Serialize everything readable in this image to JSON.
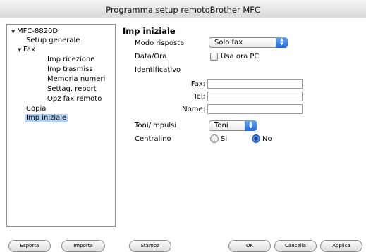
{
  "window": {
    "title": "Programma setup remotoBrother MFC"
  },
  "tree": {
    "root": "MFC-8820D",
    "items": [
      {
        "label": "Setup generale"
      },
      {
        "label": "Fax"
      },
      {
        "label": "Imp ricezione"
      },
      {
        "label": "Imp trasmiss"
      },
      {
        "label": "Memoria numeri"
      },
      {
        "label": "Settag. report"
      },
      {
        "label": "Opz fax remoto"
      },
      {
        "label": "Copia"
      },
      {
        "label": "Imp iniziale"
      }
    ],
    "selected": "Imp iniziale"
  },
  "panel": {
    "title": "Imp iniziale",
    "modo_risposta": {
      "label": "Modo risposta",
      "value": "Solo fax"
    },
    "data_ora": {
      "label": "Data/Ora",
      "checkbox_label": "Usa ora PC",
      "checked": false
    },
    "identificativo": {
      "label": "Identificativo",
      "fax": {
        "label": "Fax:",
        "value": ""
      },
      "tel": {
        "label": "Tel:",
        "value": ""
      },
      "nome": {
        "label": "Nome:",
        "value": ""
      }
    },
    "toni_impulsi": {
      "label": "Toni/Impulsi",
      "value": "Toni"
    },
    "centralino": {
      "label": "Centralino",
      "options": [
        "Si",
        "No"
      ],
      "selected": "No"
    }
  },
  "buttons": {
    "esporta": "Esporta",
    "importa": "Importa",
    "stampa": "Stampa",
    "ok": "OK",
    "cancella": "Cancella",
    "applica": "Applica"
  },
  "colors": {
    "selection": "#b6d3f5",
    "accent": "#2b6fd8"
  },
  "icons": [
    "disclosure-triangle-icon",
    "popup-arrows-icon"
  ]
}
